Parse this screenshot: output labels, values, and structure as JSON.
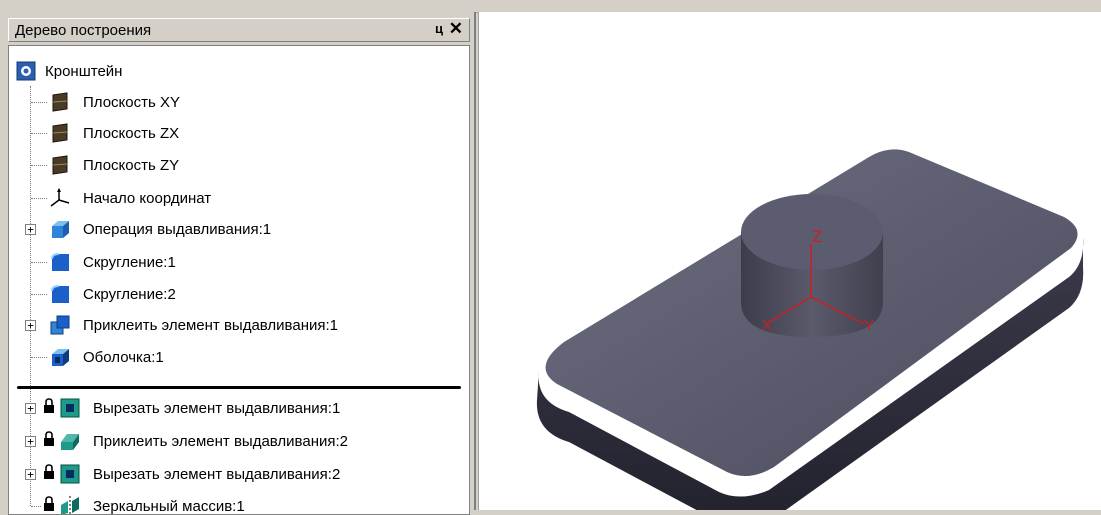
{
  "panel": {
    "title": "Дерево построения",
    "pin_label": "ц",
    "close_label": "✕"
  },
  "tree": {
    "root": "Кронштейн",
    "items": [
      {
        "label": "Плоскость XY",
        "icon": "plane-icon"
      },
      {
        "label": "Плоскость ZX",
        "icon": "plane-icon"
      },
      {
        "label": "Плоскость ZY",
        "icon": "plane-icon"
      },
      {
        "label": "Начало координат",
        "icon": "origin-icon"
      },
      {
        "label": "Операция выдавливания:1",
        "icon": "extrude-icon",
        "expandable": true
      },
      {
        "label": "Скругление:1",
        "icon": "fillet-icon"
      },
      {
        "label": "Скругление:2",
        "icon": "fillet-icon"
      },
      {
        "label": "Приклеить элемент выдавливания:1",
        "icon": "boss-extrude-icon",
        "expandable": true
      },
      {
        "label": "Оболочка:1",
        "icon": "shell-icon"
      },
      {
        "label": "Вырезать элемент выдавливания:1",
        "icon": "cut-extrude-icon",
        "expandable": true,
        "locked": true
      },
      {
        "label": "Приклеить элемент выдавливания:2",
        "icon": "boss-extrude-icon",
        "expandable": true,
        "locked": true
      },
      {
        "label": "Вырезать элемент выдавливания:2",
        "icon": "cut-extrude-icon",
        "expandable": true,
        "locked": true
      },
      {
        "label": "Зеркальный массив:1",
        "icon": "mirror-pattern-icon",
        "locked": true
      }
    ]
  },
  "viewport": {
    "axis_labels": {
      "x": "X",
      "y": "Y",
      "z": "Z"
    },
    "colors": {
      "body": "#4a4a5c",
      "axis": "#cc1f1f",
      "background": "#ffffff"
    }
  }
}
